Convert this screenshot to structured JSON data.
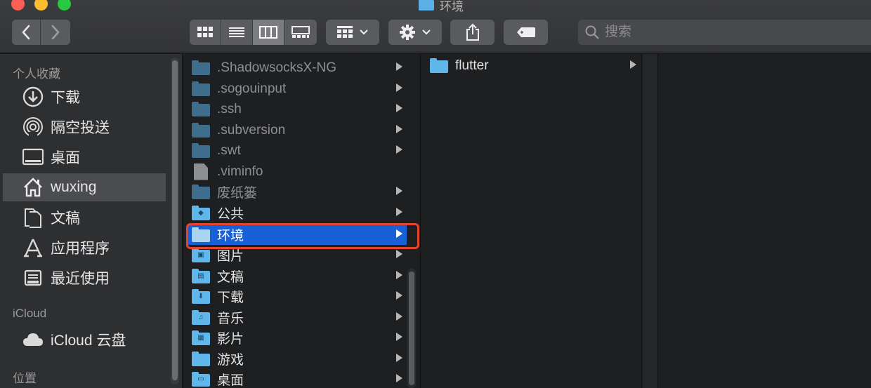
{
  "window": {
    "title": "环境"
  },
  "toolbar": {
    "search_placeholder": "搜索"
  },
  "sidebar": {
    "favorites_header": "个人收藏",
    "favorites": [
      {
        "label": "下载",
        "icon": "download-icon"
      },
      {
        "label": "隔空投送",
        "icon": "airdrop-icon"
      },
      {
        "label": "桌面",
        "icon": "desktop-icon"
      },
      {
        "label": "wuxing",
        "icon": "home-icon",
        "selected": true
      },
      {
        "label": "文稿",
        "icon": "documents-icon"
      },
      {
        "label": "应用程序",
        "icon": "applications-icon"
      },
      {
        "label": "最近使用",
        "icon": "recents-icon"
      }
    ],
    "icloud_header": "iCloud",
    "icloud": [
      {
        "label": "iCloud 云盘",
        "icon": "cloud-icon"
      }
    ],
    "locations_header": "位置"
  },
  "column1": {
    "items": [
      {
        "name": ".ShadowsocksX-NG",
        "type": "folder"
      },
      {
        "name": ".sogouinput",
        "type": "folder"
      },
      {
        "name": ".ssh",
        "type": "folder"
      },
      {
        "name": ".subversion",
        "type": "folder"
      },
      {
        "name": ".swt",
        "type": "folder"
      },
      {
        "name": ".viminfo",
        "type": "file"
      },
      {
        "name": "废纸篓",
        "type": "folder"
      },
      {
        "name": "公共",
        "type": "folder"
      },
      {
        "name": "环境",
        "type": "folder",
        "selected": true
      },
      {
        "name": "图片",
        "type": "folder"
      },
      {
        "name": "文稿",
        "type": "folder"
      },
      {
        "name": "下载",
        "type": "folder"
      },
      {
        "name": "音乐",
        "type": "folder"
      },
      {
        "name": "影片",
        "type": "folder"
      },
      {
        "name": "游戏",
        "type": "folder"
      },
      {
        "name": "桌面",
        "type": "folder"
      }
    ]
  },
  "column2": {
    "items": [
      {
        "name": "flutter",
        "type": "folder"
      }
    ]
  },
  "colors": {
    "selection": "#1860d8",
    "highlight_box": "#e3442d",
    "folder_blue": "#5fb6ea"
  }
}
